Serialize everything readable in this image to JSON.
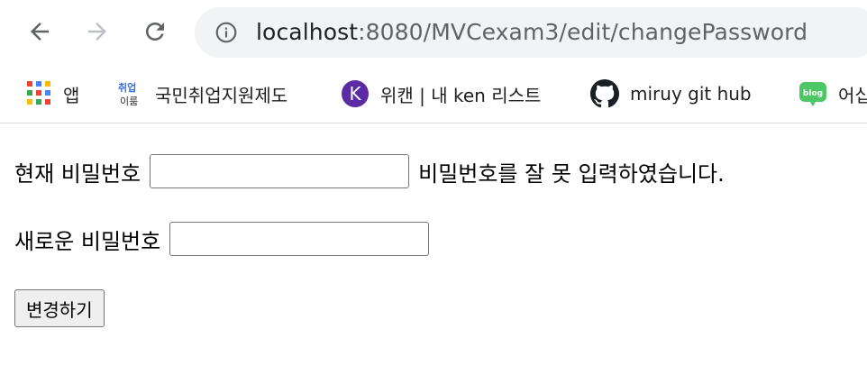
{
  "browser": {
    "url_host": "localhost",
    "url_rest": ":8080/MVCexam3/edit/changePassword"
  },
  "bookmarks": {
    "apps_label": "앱",
    "items": [
      {
        "label": "국민취업지원제도",
        "icon": "employment-support-icon",
        "icon_text_top": "취업",
        "icon_text_bottom": "이룸"
      },
      {
        "label": "위캔 | 내 ken 리스트",
        "icon": "k-logo-icon",
        "icon_text": "K"
      },
      {
        "label": "miruy git hub",
        "icon": "github-icon"
      },
      {
        "label": "어십",
        "icon": "blog-icon",
        "icon_text": "blog"
      }
    ]
  },
  "form": {
    "current_label": "현재 비밀번호",
    "current_value": "",
    "error_message": "비밀번호를 잘 못 입력하였습니다.",
    "new_label": "새로운 비밀번호",
    "new_value": "",
    "submit_label": "변경하기"
  },
  "colors": {
    "omnibox_bg": "#f1f3f4",
    "k_logo": "#5b2aa5",
    "blog_green": "#4cc764"
  }
}
